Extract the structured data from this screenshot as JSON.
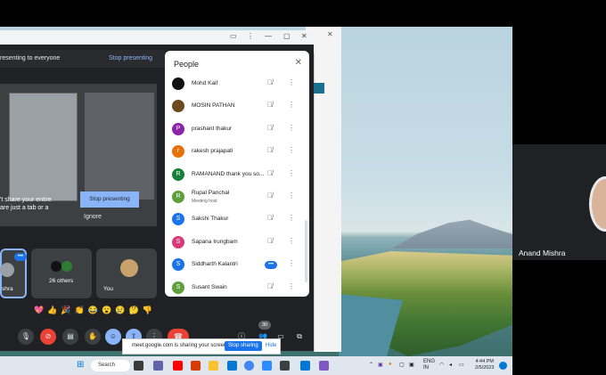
{
  "meet": {
    "present_text": "resenting to everyone",
    "stop_presenting_link": "Stop presenting",
    "share_warning_line1": "'t share your entire",
    "share_warning_line2": "are just a tab or a",
    "stop_presenting_btn": "Stop presenting",
    "ignore": "Ignore",
    "tile_self_label": "shra",
    "tile_others_label": "26 others",
    "tile_you_label": "You",
    "reactions": "💖👍🎉👏😂😮😢🤔👎",
    "participant_count": "30"
  },
  "people": {
    "title": "People",
    "close": "✕",
    "list": [
      {
        "name": "Mohd Kaif",
        "sub": "",
        "avatar": "",
        "color": "#111111",
        "muted": true
      },
      {
        "name": "MOSIN PATHAN",
        "sub": "",
        "avatar": "",
        "color": "#6b4b1e",
        "muted": true
      },
      {
        "name": "prashant thakur",
        "sub": "",
        "avatar": "P",
        "color": "#8e24aa",
        "muted": true
      },
      {
        "name": "rakesh prajapati",
        "sub": "",
        "avatar": "r",
        "color": "#e8710a",
        "muted": true
      },
      {
        "name": "RAMANAND thank you so...",
        "sub": "",
        "avatar": "R",
        "color": "#188038",
        "muted": true
      },
      {
        "name": "Rupal Panchal",
        "sub": "Meeting host",
        "avatar": "R",
        "color": "#5f9e3c",
        "muted": true
      },
      {
        "name": "Sakshi Thakur",
        "sub": "",
        "avatar": "S",
        "color": "#1a73e8",
        "muted": true
      },
      {
        "name": "Sapana Irungbam",
        "sub": "",
        "avatar": "S",
        "color": "#d93a78",
        "muted": true
      },
      {
        "name": "Siddharth Kalantri",
        "sub": "",
        "avatar": "S",
        "color": "#1a73e8",
        "muted": false
      },
      {
        "name": "Susant Swain",
        "sub": "",
        "avatar": "S",
        "color": "#5f9e3c",
        "muted": true
      }
    ]
  },
  "share_notice": {
    "message": "meet.google.com is sharing your screen.",
    "stop": "Stop sharing",
    "hide": "Hide"
  },
  "taskbar": {
    "search": "Search",
    "lang": "ENG IN",
    "time": "4:44 PM",
    "date": "2/5/2023"
  },
  "right": {
    "name": "Anand Mishra"
  }
}
